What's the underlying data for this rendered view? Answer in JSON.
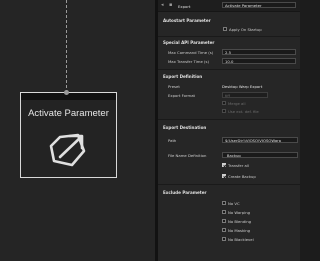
{
  "node": {
    "title": "Activate Parameter",
    "icon": "hexagon-arrow-icon"
  },
  "panel": {
    "type_label": "Export",
    "name_value": "Activate Parameter",
    "icons": [
      "collapse-icon",
      "node-type-icon"
    ],
    "sections": {
      "autostart": {
        "title": "Autostart Parameter",
        "apply_on_startup": "Apply On Startup"
      },
      "special_api": {
        "title": "Special API Parameter",
        "max_command_time_label": "Max Command Time (s)",
        "max_command_time_value": "2.5",
        "max_transfer_time_label": "Max Transfer Time (s)",
        "max_transfer_time_value": "10.0"
      },
      "export_definition": {
        "title": "Export Definition",
        "preset_label": "Preset",
        "preset_value": "Desktop Warp Export",
        "format_label": "Export Format",
        "format_value": "tiff",
        "merge_all": "Merge all",
        "use_ext_def_file": "Use ext. def. file"
      },
      "export_destination": {
        "title": "Export Destination",
        "path_label": "Path",
        "path_value": "$(UserDir)\\VIOSO\\VIOSOWarp",
        "file_name_label": "File Name Definition",
        "file_name_value": "_Backup",
        "transfer_all": "Transfer all",
        "create_backup": "Create Backup"
      },
      "exclude": {
        "title": "Exclude Parameter",
        "items": [
          "No VC",
          "No Warping",
          "No Blending",
          "No Masking",
          "No Blacklevel"
        ]
      }
    }
  },
  "colors": {
    "canvas_bg": "#252525",
    "panel_bg": "#262626",
    "node_border": "#d8d8d8",
    "text": "#cfcfcf"
  }
}
